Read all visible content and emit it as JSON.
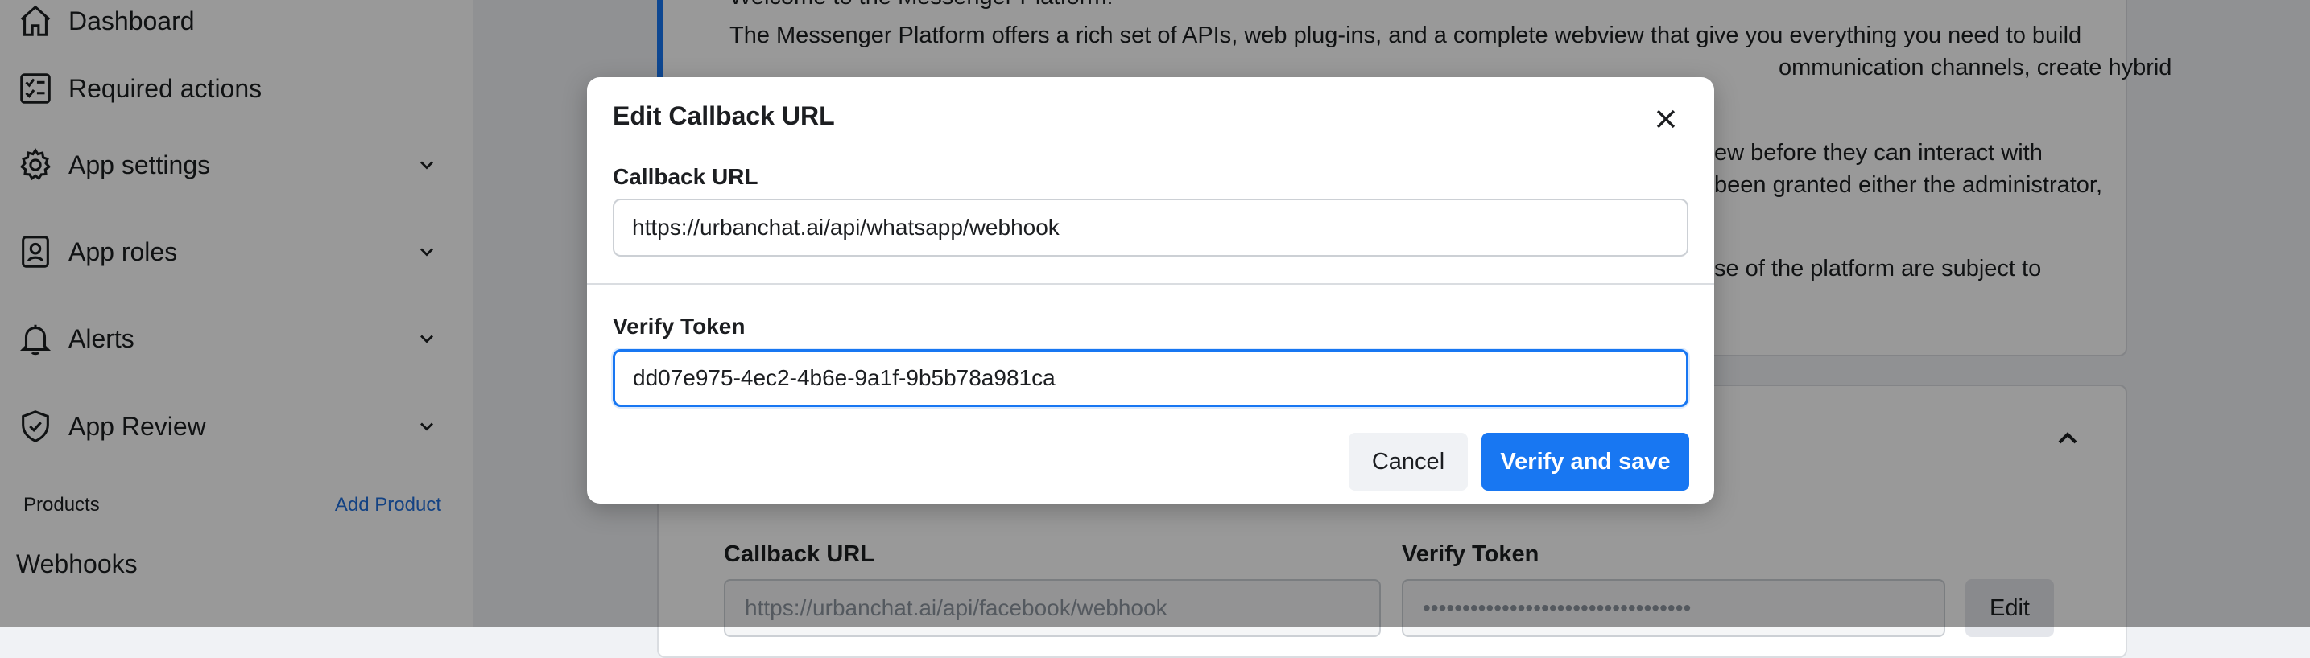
{
  "sidebar": {
    "items": [
      {
        "label": "Dashboard",
        "icon": "home-icon"
      },
      {
        "label": "Required actions",
        "icon": "checklist-icon"
      },
      {
        "label": "App settings",
        "icon": "gear-icon"
      },
      {
        "label": "App roles",
        "icon": "id-badge-icon"
      },
      {
        "label": "Alerts",
        "icon": "bell-icon"
      },
      {
        "label": "App Review",
        "icon": "shield-check-icon"
      }
    ],
    "products_heading": "Products",
    "add_product_label": "Add Product",
    "webhooks_label": "Webhooks"
  },
  "background": {
    "intro_lines": [
      "Welcome to the Messenger Platform!",
      "The Messenger Platform offers a rich set of APIs, web plug-ins, and a complete webview that give you everything you need to build",
      "ommunication channels, create hybrid",
      "ew before they can interact with",
      "been granted either the administrator,",
      "se of the platform are subject to"
    ],
    "callback_url_label": "Callback URL",
    "callback_url_value": "https://urbanchat.ai/api/facebook/webhook",
    "verify_token_label": "Verify Token",
    "verify_token_masked": "••••••••••••••••••••••••••••••••••",
    "edit_label": "Edit"
  },
  "modal": {
    "title": "Edit Callback URL",
    "callback_url_label": "Callback URL",
    "callback_url_value": "https://urbanchat.ai/api/whatsapp/webhook",
    "verify_token_label": "Verify Token",
    "verify_token_value": "dd07e975-4ec2-4b6e-9a1f-9b5b78a981ca",
    "cancel_label": "Cancel",
    "submit_label": "Verify and save"
  },
  "colors": {
    "accent": "#1877f2",
    "link": "#216fdb",
    "overlay": "rgba(0,0,0,0.4)"
  }
}
